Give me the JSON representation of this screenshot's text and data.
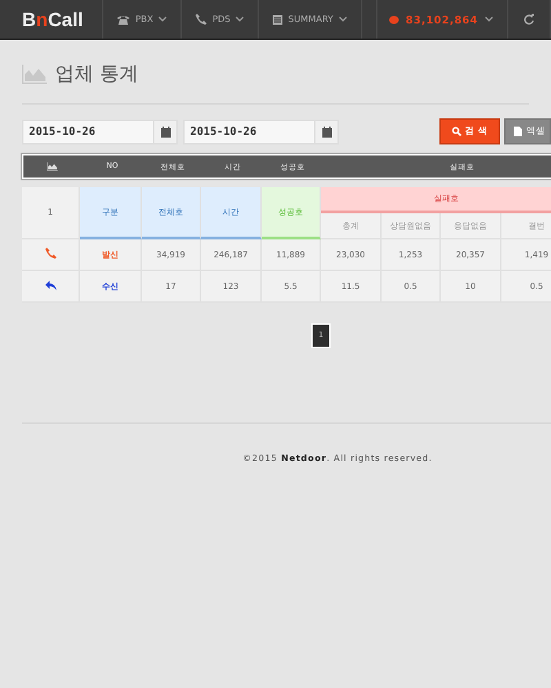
{
  "navbar": {
    "logo": [
      {
        "text": "B",
        "accent": false
      },
      {
        "text": "n",
        "accent": true
      },
      {
        "text": "Call",
        "accent": false
      }
    ],
    "menus": [
      {
        "label": "PBX"
      },
      {
        "label": "PDS"
      },
      {
        "label": "SUMMARY"
      }
    ],
    "balance": "83,102,864"
  },
  "page_title": "업체 통계",
  "filters": {
    "start_date": "2015-10-26",
    "end_date": "2015-10-26",
    "search_button": "검 색",
    "excel_button": "엑셀"
  },
  "summary_header": {
    "columns": [
      "NO",
      "전체호",
      "시간",
      "성공호",
      "실패호"
    ]
  },
  "table": {
    "no": "1",
    "groups": [
      {
        "label": "구분",
        "color": "#deedfd"
      },
      {
        "label": "전체호",
        "color": "#deedfd"
      },
      {
        "label": "시간",
        "color": "#deedfd"
      },
      {
        "label": "성공호",
        "color": "#e4f8dd"
      }
    ],
    "failure": {
      "label": "실패호",
      "columns": [
        "총계",
        "상담원없음",
        "응답없음",
        "결번"
      ]
    },
    "rows": [
      {
        "kind": "outgoing",
        "label": "발신",
        "color": "#f05a28",
        "cells": [
          "34,919",
          "246,187",
          "11,889",
          "23,030",
          "1,253",
          "20,357",
          "1,419"
        ]
      },
      {
        "kind": "incoming",
        "label": "수신",
        "color": "#1f3fd8",
        "cells": [
          "17",
          "123",
          "5.5",
          "11.5",
          "0.5",
          "10",
          "0.5"
        ]
      }
    ]
  },
  "pagination": [
    {
      "label": "1",
      "selected": true
    }
  ],
  "footer": "©2015 **Netdoor**. All rights reserved."
}
